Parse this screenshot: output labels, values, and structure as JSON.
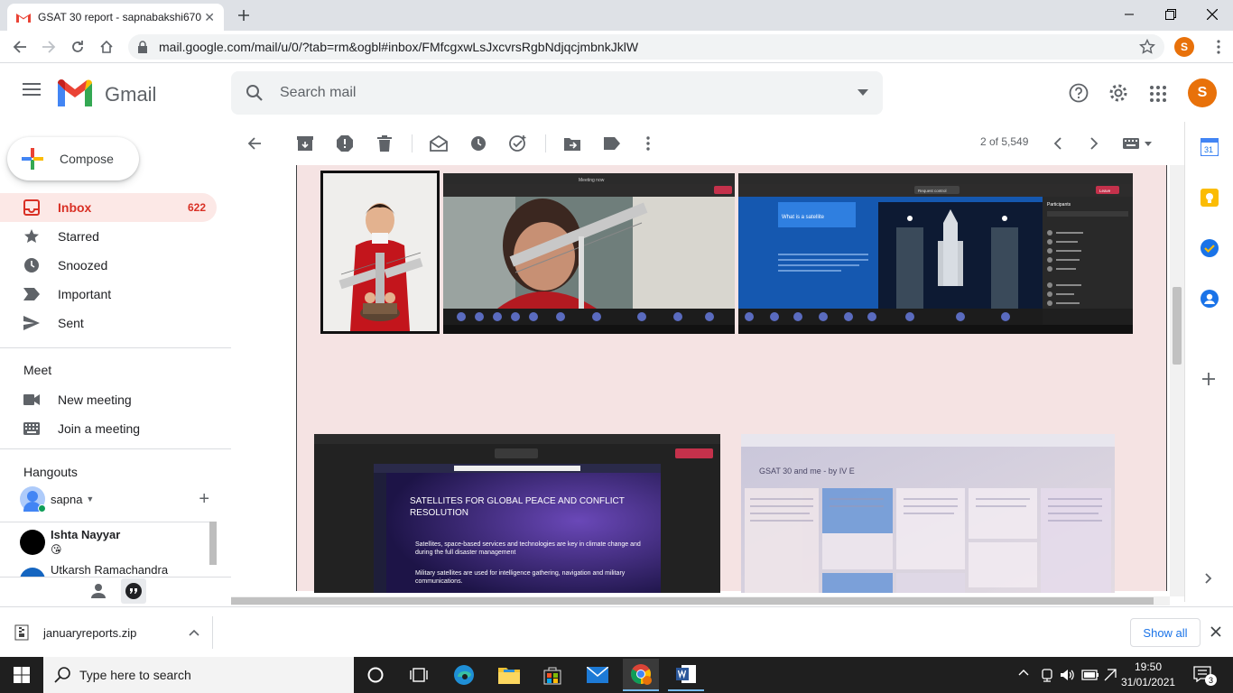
{
  "browser": {
    "tab_title": "GSAT 30 report - sapnabakshi670",
    "url": "mail.google.com/mail/u/0/?tab=rm&ogbl#inbox/FMfcgxwLsJxcvrsRgbNdjqcjmbnkJklW",
    "profile_initial": "S"
  },
  "gmail": {
    "logo_text": "Gmail",
    "search_placeholder": "Search mail",
    "account_initial": "S"
  },
  "sidebar": {
    "compose_label": "Compose",
    "items": [
      {
        "label": "Inbox",
        "count": "622",
        "icon": "inbox-icon"
      },
      {
        "label": "Starred",
        "count": "",
        "icon": "star-icon"
      },
      {
        "label": "Snoozed",
        "count": "",
        "icon": "clock-icon"
      },
      {
        "label": "Important",
        "count": "",
        "icon": "important-icon"
      },
      {
        "label": "Sent",
        "count": "",
        "icon": "send-icon"
      }
    ],
    "meet": {
      "title": "Meet",
      "new_meeting": "New meeting",
      "join_meeting": "Join a meeting"
    },
    "hangouts": {
      "title": "Hangouts",
      "user": "sapna",
      "contacts": [
        {
          "name": "Ishta Nayyar",
          "status": "😘"
        },
        {
          "name": "Utkarsh Ramachandra",
          "status": ""
        }
      ]
    }
  },
  "toolbar": {
    "pager": "2 of 5,549"
  },
  "email_images": {
    "slide1_title": "What is a satellite",
    "slide2_title": "SATELLITES FOR GLOBAL PEACE AND CONFLICT RESOLUTION",
    "slide2_bullets": [
      "Satellites, space-based services and technologies are key in climate change and during the full disaster management",
      "Military satellites are used for intelligence gathering, navigation and military communications."
    ],
    "padlet_title": "GSAT 30 and me - by IV E",
    "meeting_now": "Meeting now",
    "request_control": "Request control",
    "leave": "Leave",
    "participants": "Participants"
  },
  "download": {
    "file": "januaryreports.zip",
    "show_all": "Show all"
  },
  "taskbar": {
    "search_placeholder": "Type here to search",
    "time": "19:50",
    "date": "31/01/2021",
    "notifications": "3"
  },
  "colors": {
    "gmail_red": "#d93025",
    "inbox_highlight": "#fce8e6",
    "email_bg": "#f5e3e3",
    "profile_orange": "#e8710a"
  }
}
